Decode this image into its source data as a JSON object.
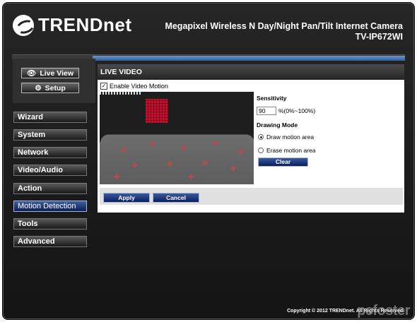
{
  "brand": {
    "logo_text": "TRENDnet"
  },
  "product": {
    "line1": "Megapixel Wireless N Day/Night Pan/Tilt Internet Camera",
    "line2": "TV-IP672WI"
  },
  "view_buttons": {
    "live_view": "Live View",
    "setup": "Setup"
  },
  "nav": {
    "wizard": "Wizard",
    "system": "System",
    "network": "Network",
    "video_audio": "Video/Audio",
    "action": "Action",
    "motion_detection": "Motion Detection",
    "tools": "Tools",
    "advanced": "Advanced"
  },
  "panel": {
    "title": "LIVE VIDEO",
    "enable_label": "Enable Video Motion",
    "enable_checked": true,
    "sensitivity_label": "Sensitivity",
    "sensitivity_value": "90",
    "sensitivity_range": "%(0%~100%)",
    "drawing_mode_label": "Drawing Mode",
    "draw_option": "Draw motion area",
    "erase_option": "Erase motion area",
    "selected_mode": "Draw motion area",
    "clear_label": "Clear"
  },
  "actions": {
    "apply": "Apply",
    "cancel": "Cancel"
  },
  "footer": {
    "copyright": "Copyright © 2012 TRENDnet. All Rights Reserved.",
    "watermark": "pcfoster"
  },
  "colors": {
    "nav_active": "#1a3a8a",
    "accent_blue": "#3a5a9f",
    "motion_area": "#c8102e"
  }
}
